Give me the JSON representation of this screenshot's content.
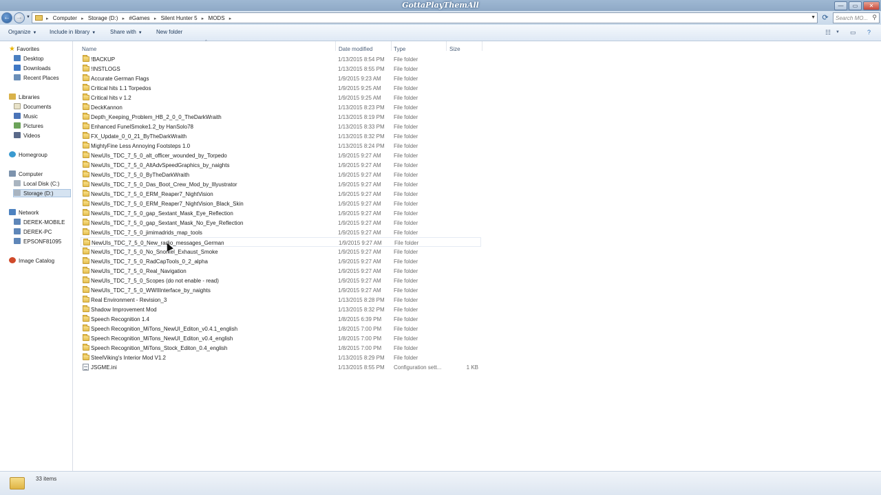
{
  "window": {
    "title": "GottaPlayThemAll",
    "minimize": "—",
    "maximize": "▭",
    "close": "✕"
  },
  "address": {
    "breadcrumbs": [
      "Computer",
      "Storage (D:)",
      "#Games",
      "Silent Hunter 5",
      "MODS"
    ],
    "search_placeholder": "Search MO..."
  },
  "toolbar": {
    "organize": "Organize",
    "include_in_library": "Include in library",
    "share_with": "Share with",
    "new_folder": "New folder"
  },
  "sidebar": {
    "favorites": "Favorites",
    "desktop": "Desktop",
    "downloads": "Downloads",
    "recent_places": "Recent Places",
    "libraries": "Libraries",
    "documents": "Documents",
    "music": "Music",
    "pictures": "Pictures",
    "videos": "Videos",
    "homegroup": "Homegroup",
    "computer": "Computer",
    "local_disk": "Local Disk (C:)",
    "storage": "Storage (D:)",
    "network": "Network",
    "derek_mobile": "DEREK-MOBILE",
    "derek_pc": "DEREK-PC",
    "epson": "EPSONF81095",
    "image_catalog": "Image Catalog"
  },
  "columns": {
    "name": "Name",
    "date_modified": "Date modified",
    "type": "Type",
    "size": "Size"
  },
  "files": [
    {
      "name": "!BACKUP",
      "date": "1/13/2015 8:54 PM",
      "type": "File folder",
      "size": "",
      "kind": "folder"
    },
    {
      "name": "!INSTLOGS",
      "date": "1/13/2015 8:55 PM",
      "type": "File folder",
      "size": "",
      "kind": "folder"
    },
    {
      "name": "Accurate German Flags",
      "date": "1/9/2015 9:23 AM",
      "type": "File folder",
      "size": "",
      "kind": "folder"
    },
    {
      "name": "Critical hits 1.1 Torpedos",
      "date": "1/9/2015 9:25 AM",
      "type": "File folder",
      "size": "",
      "kind": "folder"
    },
    {
      "name": "Critical hits v 1.2",
      "date": "1/9/2015 9:25 AM",
      "type": "File folder",
      "size": "",
      "kind": "folder"
    },
    {
      "name": "DeckKannon",
      "date": "1/13/2015 8:23 PM",
      "type": "File folder",
      "size": "",
      "kind": "folder"
    },
    {
      "name": "Depth_Keeping_Problem_HB_2_0_0_TheDarkWraith",
      "date": "1/13/2015 8:19 PM",
      "type": "File folder",
      "size": "",
      "kind": "folder"
    },
    {
      "name": "Enhanced FunelSmoke1.2_by HanSolo78",
      "date": "1/13/2015 8:33 PM",
      "type": "File folder",
      "size": "",
      "kind": "folder"
    },
    {
      "name": "FX_Update_0_0_21_ByTheDarkWraith",
      "date": "1/13/2015 8:32 PM",
      "type": "File folder",
      "size": "",
      "kind": "folder"
    },
    {
      "name": "MightyFine Less Annoying Footsteps 1.0",
      "date": "1/13/2015 8:24 PM",
      "type": "File folder",
      "size": "",
      "kind": "folder"
    },
    {
      "name": "NewUIs_TDC_7_5_0_alt_officer_wounded_by_Torpedo",
      "date": "1/9/2015 9:27 AM",
      "type": "File folder",
      "size": "",
      "kind": "folder"
    },
    {
      "name": "NewUIs_TDC_7_5_0_AltAdvSpeedGraphics_by_naights",
      "date": "1/9/2015 9:27 AM",
      "type": "File folder",
      "size": "",
      "kind": "folder"
    },
    {
      "name": "NewUIs_TDC_7_5_0_ByTheDarkWraith",
      "date": "1/9/2015 9:27 AM",
      "type": "File folder",
      "size": "",
      "kind": "folder"
    },
    {
      "name": "NewUIs_TDC_7_5_0_Das_Boot_Crew_Mod_by_Illyustrator",
      "date": "1/9/2015 9:27 AM",
      "type": "File folder",
      "size": "",
      "kind": "folder"
    },
    {
      "name": "NewUIs_TDC_7_5_0_ERM_Reaper7_NightVision",
      "date": "1/9/2015 9:27 AM",
      "type": "File folder",
      "size": "",
      "kind": "folder"
    },
    {
      "name": "NewUIs_TDC_7_5_0_ERM_Reaper7_NightVision_Black_Skin",
      "date": "1/9/2015 9:27 AM",
      "type": "File folder",
      "size": "",
      "kind": "folder"
    },
    {
      "name": "NewUIs_TDC_7_5_0_gap_Sextant_Mask_Eye_Reflection",
      "date": "1/9/2015 9:27 AM",
      "type": "File folder",
      "size": "",
      "kind": "folder"
    },
    {
      "name": "NewUIs_TDC_7_5_0_gap_Sextant_Mask_No_Eye_Reflection",
      "date": "1/9/2015 9:27 AM",
      "type": "File folder",
      "size": "",
      "kind": "folder"
    },
    {
      "name": "NewUIs_TDC_7_5_0_jimimadrids_map_tools",
      "date": "1/9/2015 9:27 AM",
      "type": "File folder",
      "size": "",
      "kind": "folder"
    },
    {
      "name": "NewUIs_TDC_7_5_0_New_radio_messages_German",
      "date": "1/9/2015 9:27 AM",
      "type": "File folder",
      "size": "",
      "kind": "folder"
    },
    {
      "name": "NewUIs_TDC_7_5_0_No_Snorkel_Exhaust_Smoke",
      "date": "1/9/2015 9:27 AM",
      "type": "File folder",
      "size": "",
      "kind": "folder"
    },
    {
      "name": "NewUIs_TDC_7_5_0_RadCapTools_0_2_alpha",
      "date": "1/9/2015 9:27 AM",
      "type": "File folder",
      "size": "",
      "kind": "folder"
    },
    {
      "name": "NewUIs_TDC_7_5_0_Real_Navigation",
      "date": "1/9/2015 9:27 AM",
      "type": "File folder",
      "size": "",
      "kind": "folder"
    },
    {
      "name": "NewUIs_TDC_7_5_0_Scopes (do not enable - read)",
      "date": "1/9/2015 9:27 AM",
      "type": "File folder",
      "size": "",
      "kind": "folder"
    },
    {
      "name": "NewUIs_TDC_7_5_0_WWIIInterface_by_naights",
      "date": "1/9/2015 9:27 AM",
      "type": "File folder",
      "size": "",
      "kind": "folder"
    },
    {
      "name": "Real Environment - Revision_3",
      "date": "1/13/2015 8:28 PM",
      "type": "File folder",
      "size": "",
      "kind": "folder"
    },
    {
      "name": "Shadow Improvement Mod",
      "date": "1/13/2015 8:32 PM",
      "type": "File folder",
      "size": "",
      "kind": "folder"
    },
    {
      "name": "Speech Recognition 1.4",
      "date": "1/8/2015 6:39 PM",
      "type": "File folder",
      "size": "",
      "kind": "folder"
    },
    {
      "name": "Speech Recognition_MiTons_NewUI_Editon_v0.4.1_english",
      "date": "1/8/2015 7:00 PM",
      "type": "File folder",
      "size": "",
      "kind": "folder"
    },
    {
      "name": "Speech Recognition_MiTons_NewUI_Editon_v0.4_english",
      "date": "1/8/2015 7:00 PM",
      "type": "File folder",
      "size": "",
      "kind": "folder"
    },
    {
      "name": "Speech Recognition_MiTons_Stock_Editon_0.4_english",
      "date": "1/8/2015 7:00 PM",
      "type": "File folder",
      "size": "",
      "kind": "folder"
    },
    {
      "name": "SteelViking's Interior Mod V1.2",
      "date": "1/13/2015 8:29 PM",
      "type": "File folder",
      "size": "",
      "kind": "folder"
    },
    {
      "name": "JSGME.ini",
      "date": "1/13/2015 8:55 PM",
      "type": "Configuration sett...",
      "size": "1 KB",
      "kind": "ini"
    }
  ],
  "hovered_row": 19,
  "status": {
    "item_count": "33 items"
  },
  "colors": {
    "accent": "#1e395b",
    "folder": "#e5bf4f",
    "titlebar": "#9fb8d3"
  }
}
